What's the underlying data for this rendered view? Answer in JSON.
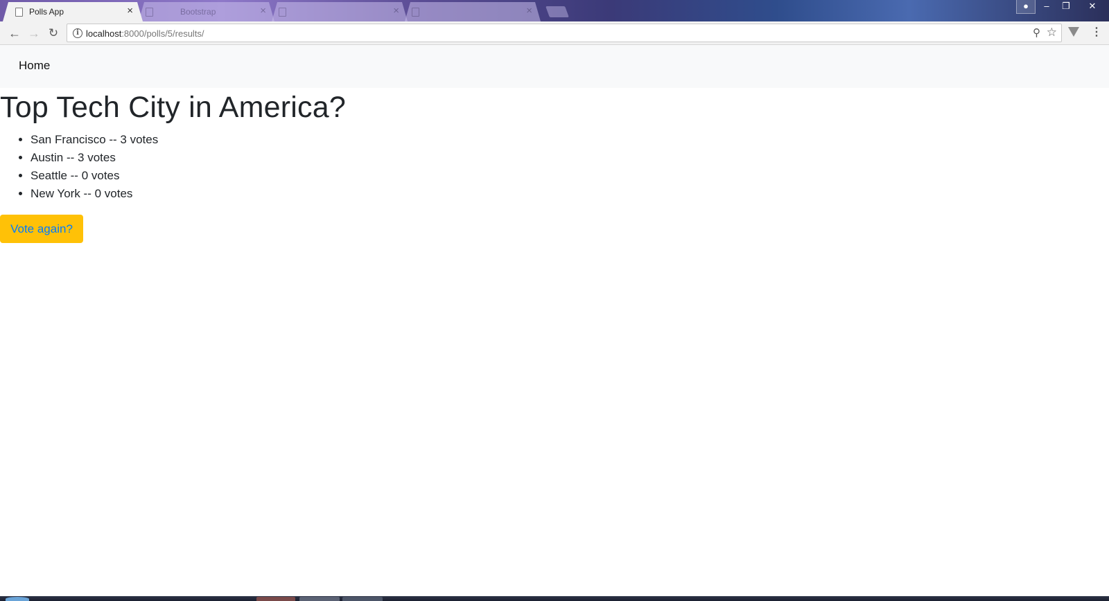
{
  "browser": {
    "tabs": [
      {
        "title": "Polls App",
        "active": true
      },
      {
        "title": "Bootstrap",
        "active": false
      },
      {
        "title": "",
        "active": false
      },
      {
        "title": "",
        "active": false
      }
    ],
    "url_host": "localhost",
    "url_rest": ":8000/polls/5/results/"
  },
  "navbar": {
    "home_label": "Home"
  },
  "poll": {
    "question": "Top Tech City in America?",
    "results": [
      "San Francisco -- 3 votes",
      "Austin -- 3 votes",
      "Seattle -- 0 votes",
      "New York -- 0 votes"
    ],
    "vote_again_label": "Vote again?"
  },
  "colors": {
    "button_bg": "#ffc107",
    "button_text": "#007bff",
    "navbar_bg": "#f8f9fa"
  }
}
